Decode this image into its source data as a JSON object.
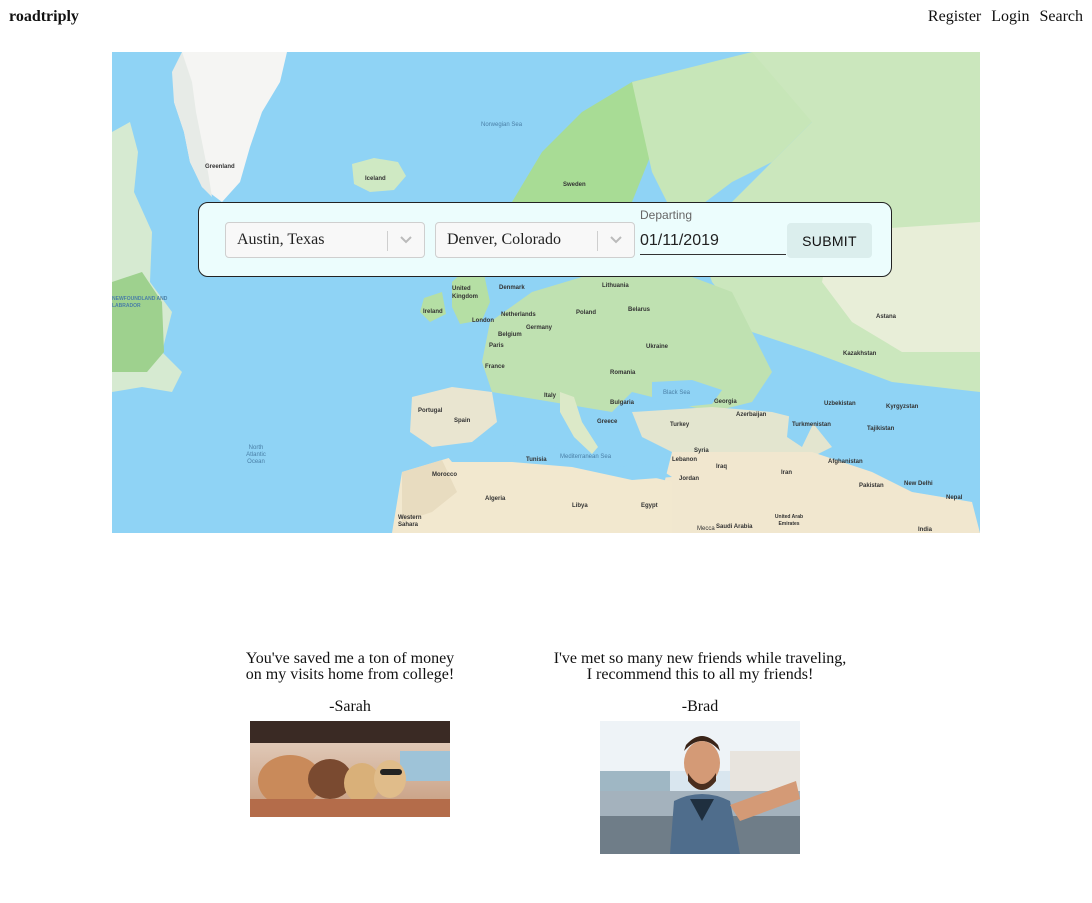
{
  "header": {
    "brand": "roadtriply",
    "nav": [
      "Register",
      "Login",
      "Search"
    ]
  },
  "search_form": {
    "origin": "Austin, Texas",
    "destination": "Denver, Colorado",
    "departing_label": "Departing",
    "departing_value": "01/11/2019",
    "submit_label": "SUBMIT"
  },
  "map_labels": {
    "greenland": "Greenland",
    "iceland": "Iceland",
    "norwegian_sea": "Norwegian Sea",
    "sweden": "Sweden",
    "united_kingdom": "United Kingdom",
    "ireland": "Ireland",
    "denmark": "Denmark",
    "lithuania": "Lithuania",
    "belarus": "Belarus",
    "poland": "Poland",
    "netherlands": "Netherlands",
    "germany": "Germany",
    "london": "London",
    "belgium": "Belgium",
    "paris": "Paris",
    "france": "France",
    "ukraine": "Ukraine",
    "romania": "Romania",
    "kazakhstan": "Kazakhstan",
    "black_sea": "Black Sea",
    "georgia": "Georgia",
    "uzbekistan": "Uzbekistan",
    "azerbaijan": "Azerbaijan",
    "turkmenistan": "Turkmenistan",
    "tajikistan": "Tajikistan",
    "portugal": "Portugal",
    "spain": "Spain",
    "italy": "Italy",
    "greece": "Greece",
    "turkey": "Turkey",
    "bulgaria": "Bulgaria",
    "iraq": "Iraq",
    "iran": "Iran",
    "afghanistan": "Afghanistan",
    "pakistan": "Pakistan",
    "north_atlantic": "North Atlantic Ocean",
    "tunisia": "Tunisia",
    "mediterranean": "Mediterranean Sea",
    "morocco": "Morocco",
    "algeria": "Algeria",
    "libya": "Libya",
    "egypt": "Egypt",
    "western_sahara": "Western Sahara",
    "saudi_arabia": "Saudi Arabia",
    "uae": "United Arab Emirates",
    "india": "India",
    "jordan": "Jordan",
    "syria": "Syria",
    "lebanon": "Lebanon",
    "mecca": "Mecca",
    "nepal": "Nepal",
    "newfoundland": "NEWFOUNDLAND AND LABRADOR",
    "astana": "Astana",
    "kyrgyzstan": "Kyrgyzstan",
    "new_delhi": "New Delhi"
  },
  "testimonials": [
    {
      "quote_line1": "You've saved me a ton of money",
      "quote_line2": "on my visits home from college!",
      "author": "-Sarah"
    },
    {
      "quote_line1": "I've met so many new friends while traveling,",
      "quote_line2": "I recommend this to all my friends!",
      "author": "-Brad"
    }
  ]
}
